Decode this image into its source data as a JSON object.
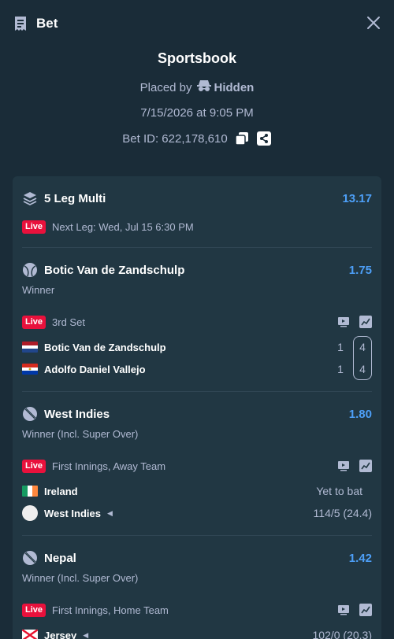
{
  "header": {
    "title": "Bet"
  },
  "summary": {
    "book": "Sportsbook",
    "placed_by": "Placed by",
    "user": "Hidden",
    "date": "7/15/2026 at 9:05 PM",
    "bet_id": "Bet ID: 622,178,610"
  },
  "multi": {
    "title": "5 Leg Multi",
    "odds": "13.17",
    "live": "Live",
    "next_leg": "Next Leg: Wed, Jul 15 6:30 PM"
  },
  "legs": [
    {
      "name": "Botic Van de Zandschulp",
      "odds": "1.75",
      "market": "Winner",
      "live": "Live",
      "status": "3rd Set",
      "teams": [
        {
          "name": "Botic Van de Zandschulp",
          "set": "1",
          "game": "4"
        },
        {
          "name": "Adolfo Daniel Vallejo",
          "set": "1",
          "game": "4"
        }
      ]
    },
    {
      "name": "West Indies",
      "odds": "1.80",
      "market": "Winner (Incl. Super Over)",
      "live": "Live",
      "status": "First Innings, Away Team",
      "teams": [
        {
          "name": "Ireland",
          "score": "Yet to bat"
        },
        {
          "name": "West Indies",
          "score": "114/5 (24.4)"
        }
      ]
    },
    {
      "name": "Nepal",
      "odds": "1.42",
      "market": "Winner (Incl. Super Over)",
      "live": "Live",
      "status": "First Innings, Home Team",
      "teams": [
        {
          "name": "Jersey",
          "score": "102/0 (20.3)"
        }
      ]
    }
  ],
  "colors": {
    "background": "#1a2c38",
    "card": "#213743",
    "odds": "#4d9ff7",
    "live": "#e9113c"
  }
}
